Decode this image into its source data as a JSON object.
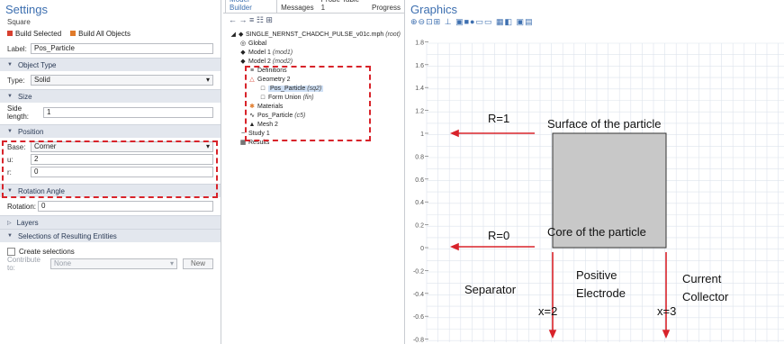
{
  "settings": {
    "title": "Settings",
    "subtitle": "Square",
    "build_selected": "Build Selected",
    "build_all": "Build All Objects",
    "label_label": "Label:",
    "label_value": "Pos_Particle",
    "object_type": {
      "header": "Object Type",
      "type_label": "Type:",
      "type_value": "Solid"
    },
    "size": {
      "header": "Size",
      "side_label": "Side length:",
      "side_value": "1"
    },
    "position": {
      "header": "Position",
      "base_label": "Base:",
      "base_value": "Corner",
      "u_label": "u:",
      "u_value": "2",
      "r_label": "r:",
      "r_value": "0"
    },
    "rotation": {
      "header": "Rotation Angle",
      "label": "Rotation:",
      "value": "0"
    },
    "layers": {
      "header": "Layers"
    },
    "selections": {
      "header": "Selections of Resulting Entities",
      "create_label": "Create selections",
      "contribute_label": "Contribute to:",
      "contribute_value": "None",
      "new_label": "New"
    }
  },
  "tree": {
    "tabs": [
      "Model Builder",
      "Messages",
      "Probe Table 1",
      "Progress"
    ],
    "nodes": [
      {
        "icon": "◆",
        "text": "SINGLE_NERNST_CHADCH_PULSE_v01c.mph",
        "tag": "(root)"
      },
      {
        "icon": "◎",
        "text": "Global",
        "tag": ""
      },
      {
        "icon": "◆",
        "text": "Model 1",
        "tag": "(mod1)"
      },
      {
        "icon": "◆",
        "text": "Model 2",
        "tag": "(mod2)"
      },
      {
        "icon": "≡",
        "text": "Definitions",
        "tag": ""
      },
      {
        "icon": "△",
        "text": "Geometry 2",
        "tag": ""
      },
      {
        "icon": "□",
        "text": "Pos_Particle",
        "tag": "(sq2)"
      },
      {
        "icon": "□",
        "text": "Form Union",
        "tag": "(fin)"
      },
      {
        "icon": "✱",
        "text": "Materials",
        "tag": ""
      },
      {
        "icon": "∿",
        "text": "Pos_Particle",
        "tag": "(c5)"
      },
      {
        "icon": "▲",
        "text": "Mesh 2",
        "tag": ""
      },
      {
        "icon": "~",
        "text": "Study 1",
        "tag": ""
      },
      {
        "icon": "▦",
        "text": "Results",
        "tag": ""
      }
    ]
  },
  "graphics": {
    "title": "Graphics",
    "y_ticks": [
      "1.8",
      "1.6",
      "1.4",
      "1.2",
      "1",
      "0.8",
      "0.6",
      "0.4",
      "0.2",
      "0",
      "-0.2",
      "-0.4",
      "-0.6",
      "-0.8"
    ],
    "annotations": {
      "r1": "R=1",
      "surface": "Surface of the particle",
      "r0": "R=0",
      "core": "Core of the particle",
      "separator": "Separator",
      "positive": "Positive",
      "electrode": "Electrode",
      "current": "Current",
      "collector": "Collector",
      "x2": "x=2",
      "x3": "x=3"
    },
    "colors": {
      "arrow": "#d8232a",
      "square_fill": "#c8c8c8",
      "grid": "#dde3ec"
    }
  }
}
